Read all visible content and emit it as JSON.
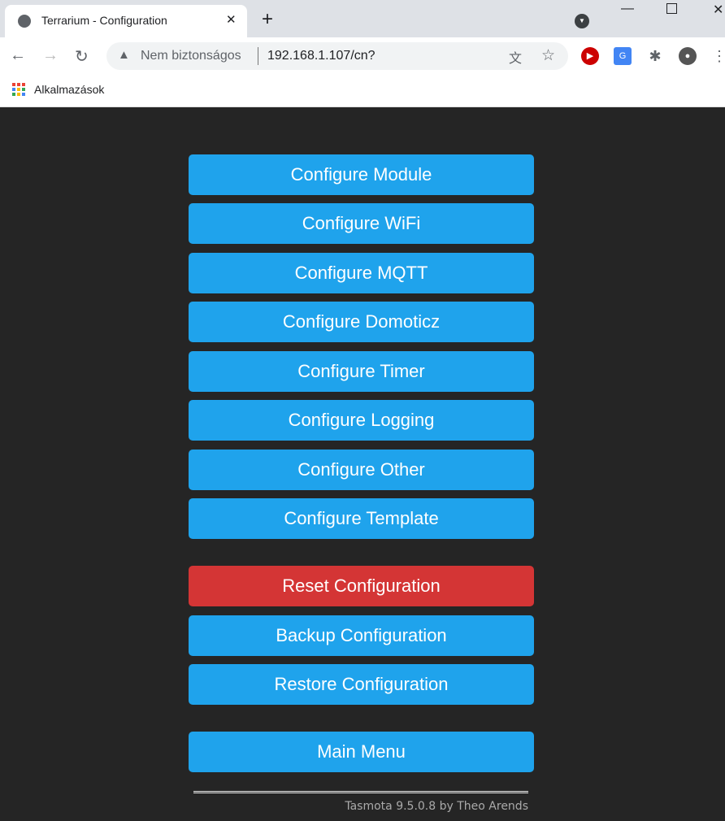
{
  "browser": {
    "tab_title": "Terrarium - Configuration",
    "security_label": "Nem biztonságos",
    "url": "192.168.1.107/cn?",
    "bookmark_apps": "Alkalmazások"
  },
  "buttons": [
    {
      "label": "Configure Module",
      "color": "#1fa3ec"
    },
    {
      "label": "Configure WiFi",
      "color": "#1fa3ec"
    },
    {
      "label": "Configure MQTT",
      "color": "#1fa3ec"
    },
    {
      "label": "Configure Domoticz",
      "color": "#1fa3ec"
    },
    {
      "label": "Configure Timer",
      "color": "#1fa3ec"
    },
    {
      "label": "Configure Logging",
      "color": "#1fa3ec"
    },
    {
      "label": "Configure Other",
      "color": "#1fa3ec"
    },
    {
      "label": "Configure Template",
      "color": "#1fa3ec"
    },
    {
      "label": "Reset Configuration",
      "color": "#d43535"
    },
    {
      "label": "Backup Configuration",
      "color": "#1fa3ec"
    },
    {
      "label": "Restore Configuration",
      "color": "#1fa3ec"
    },
    {
      "label": "Main Menu",
      "color": "#1fa3ec"
    }
  ],
  "footer": "Tasmota 9.5.0.8 by Theo Arends"
}
